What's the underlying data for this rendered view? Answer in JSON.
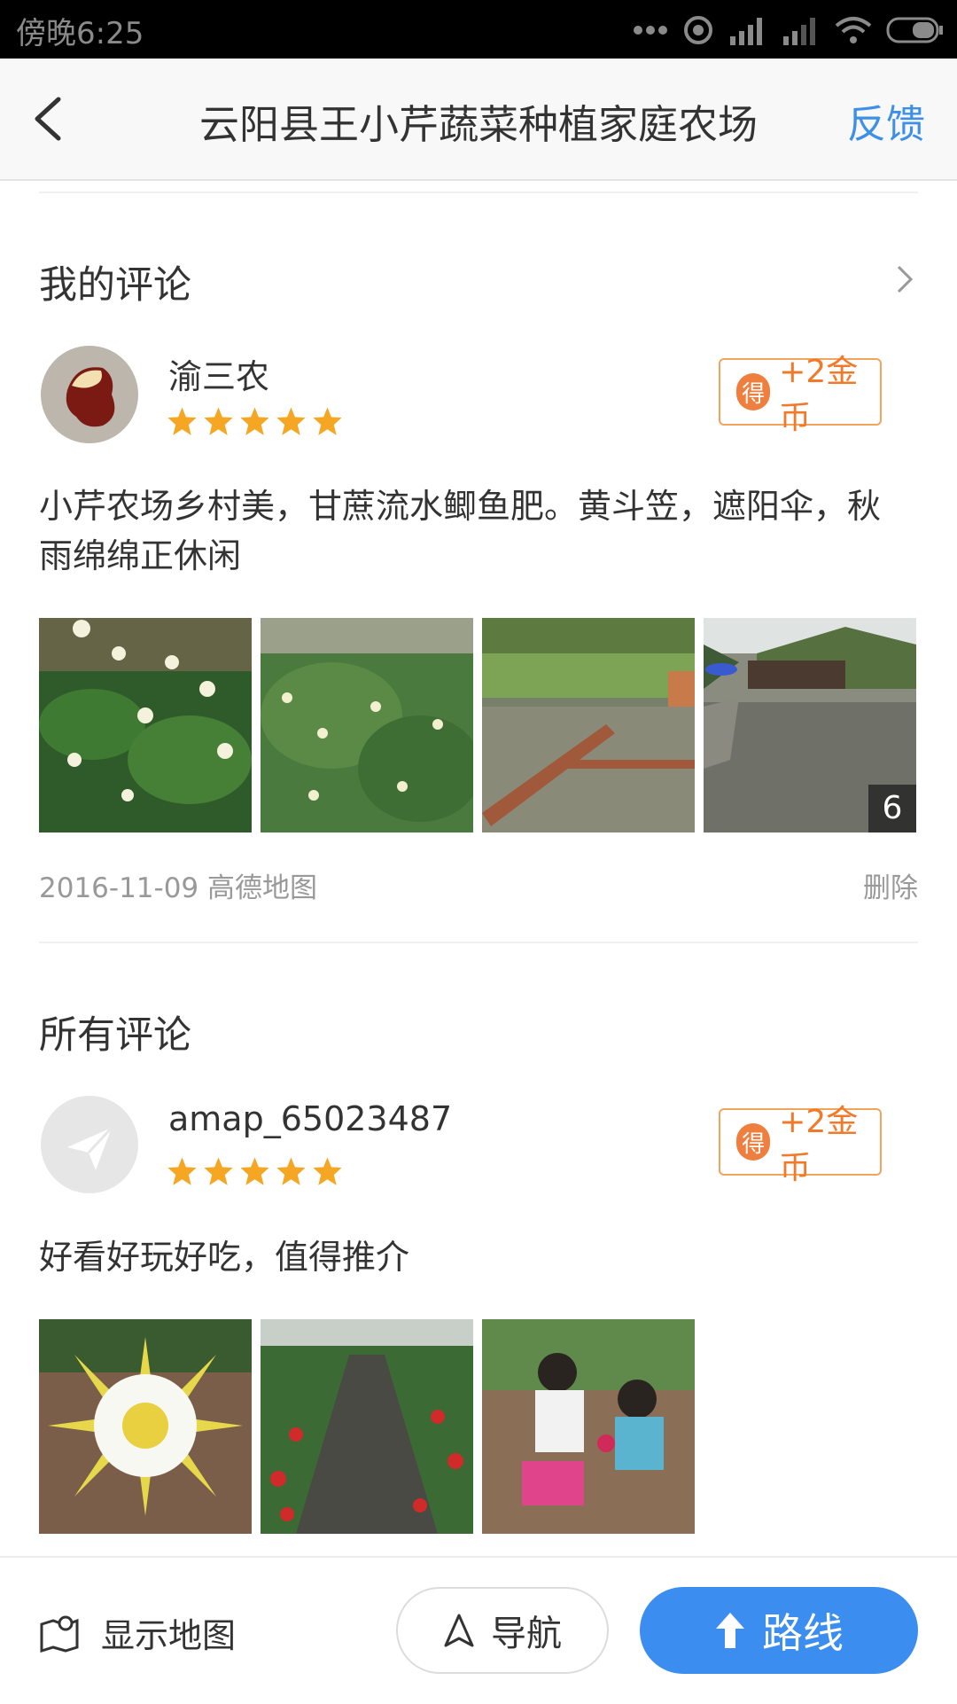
{
  "status_bar": {
    "time": "傍晚6:25",
    "icons": [
      "more-dots-icon",
      "hotspot-icon",
      "signal-icon",
      "signal-weak-icon",
      "wifi-icon",
      "battery-icon"
    ]
  },
  "nav": {
    "title": "云阳县王小芹蔬菜种植家庭农场",
    "feedback": "反馈",
    "back_icon": "back-arrow-icon"
  },
  "my_review": {
    "section_title": "我的评论",
    "user": "渝三农",
    "rating": 5,
    "coin_icon_text": "得",
    "coin_text": "+2金币",
    "text": "小芹农场乡村美，甘蔗流水鲫鱼肥。黄斗笠，遮阳伞，秋雨绵绵正休闲",
    "photos": [
      "white-chrysanthemum-photo",
      "chrysanthemum-field-photo",
      "fish-pond-photo",
      "farm-pond-house-photo"
    ],
    "more_count": "6",
    "date_source": "2016-11-09 高德地图",
    "delete": "删除"
  },
  "all_reviews": {
    "section_title": "所有评论",
    "items": [
      {
        "user": "amap_65023487",
        "rating": 5,
        "coin_icon_text": "得",
        "coin_text": "+2金币",
        "text": "好看好玩好吃，值得推介",
        "photos": [
          "dragon-fruit-flower-photo",
          "strawberry-greenhouse-photo",
          "children-picking-photo"
        ]
      }
    ]
  },
  "bottom_bar": {
    "show_map": "显示地图",
    "navigate": "导航",
    "route": "路线"
  },
  "colors": {
    "accent_blue": "#3d8fe8",
    "coin_orange": "#f0792a",
    "star_orange": "#f5a623",
    "route_button": "#3b8df0"
  }
}
